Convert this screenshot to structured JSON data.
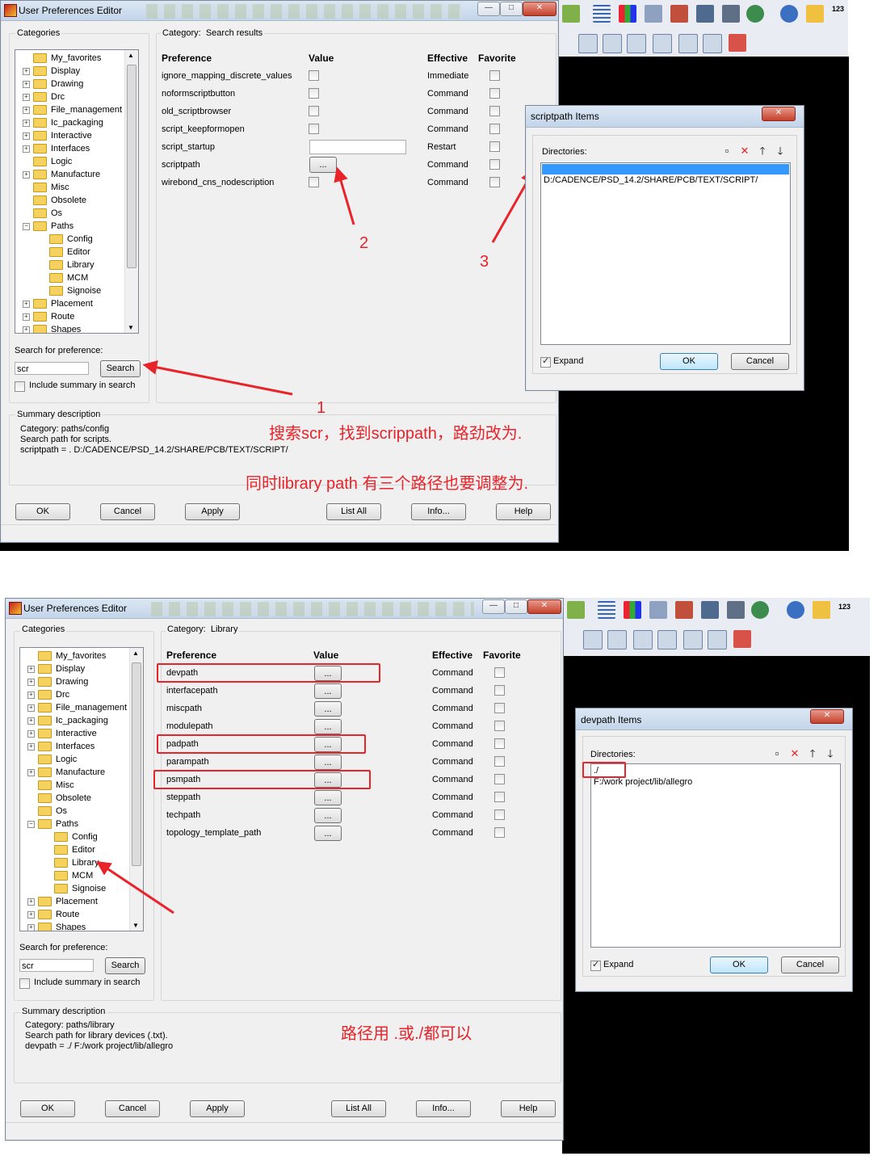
{
  "top": {
    "window_title": "User Preferences Editor",
    "categories_label": "Categories",
    "category_prefix": "Category:",
    "category_value": "Search results",
    "col_preference": "Preference",
    "col_value": "Value",
    "col_effective": "Effective",
    "col_favorite": "Favorite",
    "rows": [
      {
        "name": "ignore_mapping_discrete_values",
        "effective": "Immediate"
      },
      {
        "name": "noformscriptbutton",
        "effective": "Command"
      },
      {
        "name": "old_scriptbrowser",
        "effective": "Command"
      },
      {
        "name": "script_keepformopen",
        "effective": "Command"
      },
      {
        "name": "script_startup",
        "effective": "Restart"
      },
      {
        "name": "scriptpath",
        "effective": "Command",
        "button": "..."
      },
      {
        "name": "wirebond_cns_nodescription",
        "effective": "Command"
      }
    ],
    "search_label": "Search for preference:",
    "search_value": "scr",
    "search_button": "Search",
    "include_summary": "Include summary in search",
    "summary_label": "Summary description",
    "summary_lines": [
      "Category: paths/config",
      "Search path for scripts.",
      "scriptpath = . D:/CADENCE/PSD_14.2/SHARE/PCB/TEXT/SCRIPT/"
    ],
    "buttons": {
      "ok": "OK",
      "cancel": "Cancel",
      "apply": "Apply",
      "list_all": "List All",
      "info": "Info...",
      "help": "Help"
    },
    "annotations": {
      "n1": "1",
      "n2": "2",
      "n3": "3",
      "note1": "搜索scr，找到scrippath，路劲改为.",
      "note2": "同时library path 有三个路径也要调整为."
    },
    "dialog": {
      "title": "scriptpath Items",
      "directories_label": "Directories:",
      "entries": [
        "",
        "D:/CADENCE/PSD_14.2/SHARE/PCB/TEXT/SCRIPT/"
      ],
      "expand": "Expand",
      "ok": "OK",
      "cancel": "Cancel"
    }
  },
  "bottom": {
    "window_title": "User Preferences Editor",
    "categories_label": "Categories",
    "category_prefix": "Category:",
    "category_value": "Library",
    "col_preference": "Preference",
    "col_value": "Value",
    "col_effective": "Effective",
    "col_favorite": "Favorite",
    "rows": [
      {
        "name": "devpath",
        "effective": "Command"
      },
      {
        "name": "interfacepath",
        "effective": "Command"
      },
      {
        "name": "miscpath",
        "effective": "Command"
      },
      {
        "name": "modulepath",
        "effective": "Command"
      },
      {
        "name": "padpath",
        "effective": "Command"
      },
      {
        "name": "parampath",
        "effective": "Command"
      },
      {
        "name": "psmpath",
        "effective": "Command"
      },
      {
        "name": "steppath",
        "effective": "Command"
      },
      {
        "name": "techpath",
        "effective": "Command"
      },
      {
        "name": "topology_template_path",
        "effective": "Command"
      }
    ],
    "row_button": "...",
    "search_label": "Search for preference:",
    "search_value": "scr",
    "search_button": "Search",
    "include_summary": "Include summary in search",
    "summary_label": "Summary description",
    "summary_lines": [
      "Category: paths/library",
      "Search path for library devices (.txt).",
      "devpath = ./ F:/work project/lib/allegro"
    ],
    "buttons": {
      "ok": "OK",
      "cancel": "Cancel",
      "apply": "Apply",
      "list_all": "List All",
      "info": "Info...",
      "help": "Help"
    },
    "annotations": {
      "note": "路径用 .或./都可以"
    },
    "dialog": {
      "title": "devpath Items",
      "directories_label": "Directories:",
      "entries": [
        "./",
        "F:/work project/lib/allegro"
      ],
      "expand": "Expand",
      "ok": "OK",
      "cancel": "Cancel"
    }
  },
  "tree_items": [
    "My_favorites",
    "Display",
    "Drawing",
    "Drc",
    "File_management",
    "Ic_packaging",
    "Interactive",
    "Interfaces",
    "Logic",
    "Manufacture",
    "Misc",
    "Obsolete",
    "Os",
    "Paths",
    "Config",
    "Editor",
    "Library",
    "MCM",
    "Signoise",
    "Placement",
    "Route",
    "Shapes"
  ],
  "toolbar_label_123": "123"
}
